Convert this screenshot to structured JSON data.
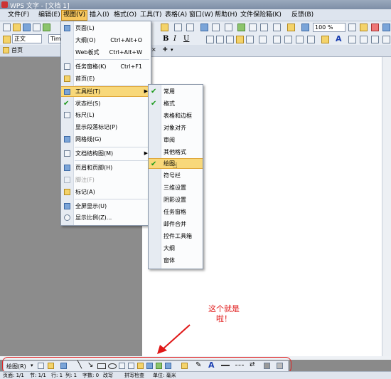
{
  "window": {
    "title": "WPS 文字 - [文档 1]"
  },
  "menubar": {
    "items": [
      {
        "label": "文件(F)"
      },
      {
        "label": "编辑(E)"
      },
      {
        "label": "视图(V)"
      },
      {
        "label": "插入(I)"
      },
      {
        "label": "格式(O)"
      },
      {
        "label": "工具(T)"
      },
      {
        "label": "表格(A)"
      },
      {
        "label": "窗口(W)"
      },
      {
        "label": "帮助(H)"
      },
      {
        "label": "文件保险箱(K)"
      },
      {
        "label": "反馈(B)"
      }
    ]
  },
  "toolbar": {
    "style_value": "正文",
    "font_value": "Tim",
    "zoom_value": "100 %",
    "bold_label": "B",
    "italic_label": "I",
    "underline_label": "U"
  },
  "tabs": {
    "home_label": "首页",
    "new_tab_label": "+"
  },
  "view_menu": {
    "items": [
      {
        "label": "页面(L)",
        "shortcut": ""
      },
      {
        "label": "大纲(O)",
        "shortcut": "Ctrl+Alt+O"
      },
      {
        "label": "Web板式",
        "shortcut": "Ctrl+Alt+W"
      },
      {
        "label": "任务窗格(K)",
        "shortcut": "Ctrl+F1"
      },
      {
        "label": "首页(E)",
        "shortcut": ""
      },
      {
        "label": "工具栏(T)",
        "shortcut": ""
      },
      {
        "label": "状态栏(S)",
        "shortcut": ""
      },
      {
        "label": "标尺(L)",
        "shortcut": ""
      },
      {
        "label": "显示段落标记(P)",
        "shortcut": ""
      },
      {
        "label": "网格线(G)",
        "shortcut": ""
      },
      {
        "label": "文档结构图(M)",
        "shortcut": ""
      },
      {
        "label": "页眉和页脚(H)",
        "shortcut": ""
      },
      {
        "label": "脚注(F)",
        "shortcut": ""
      },
      {
        "label": "标记(A)",
        "shortcut": ""
      },
      {
        "label": "全屏显示(U)",
        "shortcut": ""
      },
      {
        "label": "显示比例(Z)...",
        "shortcut": ""
      }
    ]
  },
  "toolbar_submenu": {
    "items": [
      {
        "label": "常用",
        "checked": true
      },
      {
        "label": "格式",
        "checked": true
      },
      {
        "label": "表格和边框",
        "checked": false
      },
      {
        "label": "对象对齐",
        "checked": false
      },
      {
        "label": "审阅",
        "checked": false
      },
      {
        "label": "其他格式",
        "checked": false
      },
      {
        "label": "绘图",
        "checked": true
      },
      {
        "label": "符号栏",
        "checked": false
      },
      {
        "label": "三维设置",
        "checked": false
      },
      {
        "label": "阴影设置",
        "checked": false
      },
      {
        "label": "任务窗格",
        "checked": false
      },
      {
        "label": "邮件合并",
        "checked": false
      },
      {
        "label": "控件工具箱",
        "checked": false
      },
      {
        "label": "大纲",
        "checked": false
      },
      {
        "label": "窗体",
        "checked": false
      }
    ]
  },
  "drawing_toolbar": {
    "label": "绘图(R)"
  },
  "annotation": {
    "line1": "这个就是",
    "line2": "啦！"
  },
  "statusbar": {
    "page": "页面: 1/1",
    "section": "节: 1/1",
    "row": "行: 1",
    "col": "列: 1",
    "words": "字数: 0",
    "rev": "改写",
    "spell": "拼写检查",
    "unit": "单位: 毫米"
  },
  "colors": {
    "highlight": "#f8d87a",
    "annotation": "#e01818",
    "check": "#1b9a1b"
  }
}
